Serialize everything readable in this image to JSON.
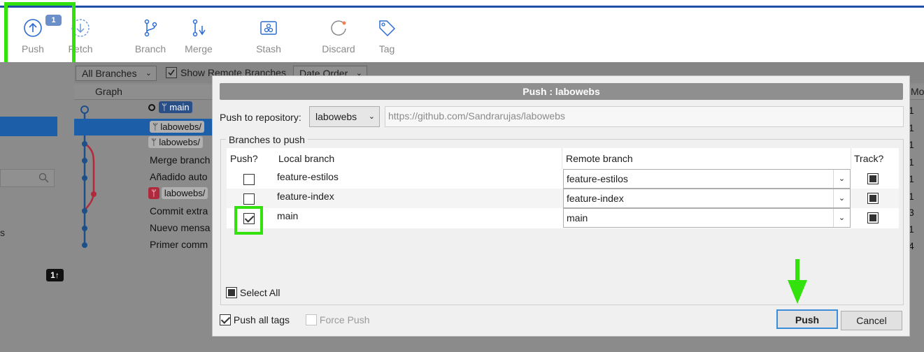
{
  "toolbar": {
    "push": {
      "label": "Push",
      "badge": "1"
    },
    "fetch": {
      "label": "Fetch"
    },
    "branch": {
      "label": "Branch"
    },
    "merge": {
      "label": "Merge"
    },
    "stash": {
      "label": "Stash"
    },
    "discard": {
      "label": "Discard"
    },
    "tag": {
      "label": "Tag"
    }
  },
  "background": {
    "branch_filter": "All Branches",
    "show_remote_label": "Show Remote Branches",
    "order": "Date Order",
    "graph_header": "Graph",
    "right_header": "Mo",
    "rows": [
      {
        "chip": "main",
        "text": ""
      },
      {
        "chip": "labowebs/",
        "text": ""
      },
      {
        "chip": "labowebs/",
        "text": ""
      },
      {
        "chip": "",
        "text": "Merge branch"
      },
      {
        "chip": "",
        "text": "Añadido auto"
      },
      {
        "chip": "labowebs/",
        "text": ""
      },
      {
        "chip": "",
        "text": "Commit extra"
      },
      {
        "chip": "",
        "text": "Nuevo mensa"
      },
      {
        "chip": "",
        "text": "Primer comm"
      }
    ],
    "right_values": [
      "1",
      "1",
      "1",
      "1",
      "1",
      "1",
      "3",
      "1",
      "4"
    ],
    "side_letter": "s",
    "counter": "1↑"
  },
  "dialog": {
    "title": "Push :  labowebs",
    "repo_label": "Push to repository:",
    "repo_value": "labowebs",
    "repo_url": "https://github.com/Sandrarujas/labowebs",
    "group_title": "Branches to push",
    "headers": {
      "push": "Push?",
      "local": "Local branch",
      "remote": "Remote branch",
      "track": "Track?"
    },
    "branches": [
      {
        "local": "feature-estilos",
        "remote": "feature-estilos",
        "push": false,
        "track": true
      },
      {
        "local": "feature-index",
        "remote": "feature-index",
        "push": false,
        "track": true
      },
      {
        "local": "main",
        "remote": "main",
        "push": true,
        "track": true
      }
    ],
    "select_all": "Select All",
    "push_all_tags": "Push all tags",
    "force_push": "Force Push",
    "push_button": "Push",
    "cancel_button": "Cancel"
  },
  "colors": {
    "highlight": "#33e10c",
    "accent": "#1f4fa8",
    "selection": "#1c5ea8"
  }
}
